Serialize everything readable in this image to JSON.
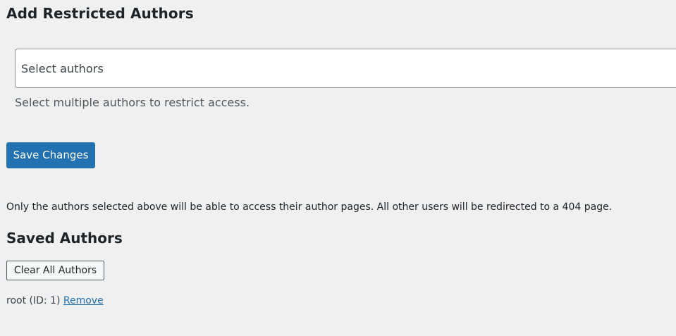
{
  "header": {
    "title": "Add Restricted Authors"
  },
  "authors_field": {
    "placeholder": "Select authors",
    "description": "Select multiple authors to restrict access."
  },
  "actions": {
    "save_label": "Save Changes"
  },
  "info": {
    "text": "Only the authors selected above will be able to access their author pages. All other users will be redirected to a 404 page."
  },
  "saved_authors": {
    "title": "Saved Authors",
    "clear_label": "Clear All Authors",
    "items": [
      {
        "label": "root (ID: 1)",
        "remove_label": "Remove"
      }
    ]
  },
  "colors": {
    "background": "#f0f0f1",
    "primary_button": "#2271b1",
    "link": "#2271b1"
  }
}
